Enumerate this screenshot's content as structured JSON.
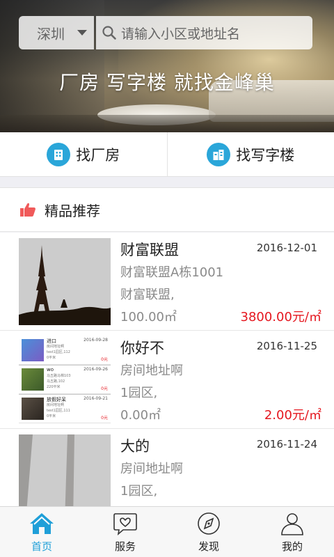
{
  "header": {
    "city": "深圳",
    "search_placeholder": "请输入小区或地址名",
    "slogan": "厂房 写字楼 就找金峰巢"
  },
  "quick_entries": [
    {
      "label": "找厂房",
      "icon": "factory-icon"
    },
    {
      "label": "找写字楼",
      "icon": "office-building-icon"
    }
  ],
  "section": {
    "title": "精品推荐",
    "icon": "thumbs-up-icon"
  },
  "listings": [
    {
      "name": "财富联盟",
      "date": "2016-12-01",
      "address": "财富联盟A栋1001",
      "park": "财富联盟,",
      "area": "100.00㎡",
      "price": "3800.00元/㎡",
      "image": "eiffel-tower-photo"
    },
    {
      "name": "你好不",
      "date": "2016-11-25",
      "address": "房间地址啊",
      "park": "1园区,",
      "area": "0.00㎡",
      "price": "2.00元/㎡",
      "image": "app-screenshot-photo",
      "mini_rows": [
        {
          "title": "进口",
          "date": "2016-09-28",
          "l1": "房间地址啊",
          "l2": "test1园区,112",
          "l3": "0平米",
          "price": "0元"
        },
        {
          "title": "wo",
          "date": "2016-09-26",
          "l1": "马五路马棉103",
          "l2": "马五路,102",
          "l3": "220平米",
          "price": "0元"
        },
        {
          "title": "放假好呆",
          "date": "2016-09-21",
          "l1": "房间地址啊",
          "l2": "test1园区,111",
          "l3": "0平米",
          "price": "0元"
        }
      ]
    },
    {
      "name": "大的",
      "date": "2016-11-24",
      "address": "房间地址啊",
      "park": "1园区,",
      "area": "",
      "price": "",
      "image": "wall-photo"
    }
  ],
  "tabs": [
    {
      "label": "首页",
      "icon": "home-icon",
      "active": true
    },
    {
      "label": "服务",
      "icon": "heart-bubble-icon",
      "active": false
    },
    {
      "label": "发现",
      "icon": "compass-icon",
      "active": false
    },
    {
      "label": "我的",
      "icon": "person-icon",
      "active": false
    }
  ],
  "colors": {
    "accent": "#1f9fd8",
    "price": "#e5171f",
    "section_icon": "#f05a5a"
  }
}
